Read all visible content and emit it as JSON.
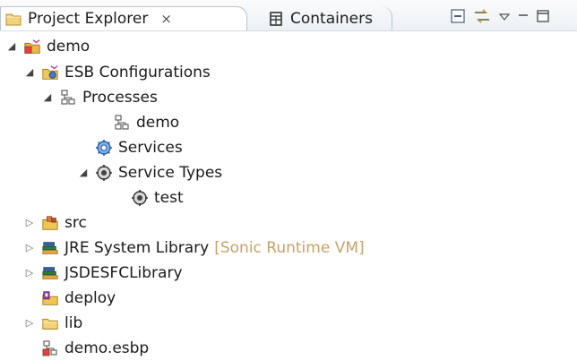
{
  "tabs": [
    {
      "label": "Project Explorer",
      "close": "×",
      "active": true,
      "icon": "project-explorer-icon"
    },
    {
      "label": "Containers",
      "active": false,
      "icon": "containers-icon"
    }
  ],
  "view_toolbar": {
    "items": [
      "collapse-all-icon",
      "link-with-editor-icon",
      "view-menu-icon",
      "minimize-icon",
      "maximize-icon"
    ]
  },
  "tree": [
    {
      "label": "demo",
      "icon": "project-icon",
      "twisty": "expanded"
    },
    {
      "label": "ESB Configurations",
      "icon": "esb-configurations-icon",
      "twisty": "expanded"
    },
    {
      "label": "Processes",
      "icon": "processes-icon",
      "twisty": "expanded"
    },
    {
      "label": "demo",
      "icon": "process-icon",
      "twisty": "none"
    },
    {
      "label": "Services",
      "icon": "services-icon",
      "twisty": "none"
    },
    {
      "label": "Service Types",
      "icon": "service-types-icon",
      "twisty": "expanded"
    },
    {
      "label": "test",
      "icon": "service-type-icon",
      "twisty": "none"
    },
    {
      "label": "src",
      "icon": "source-folder-icon",
      "twisty": "collapsed"
    },
    {
      "label": "JRE System Library",
      "decor": "[Sonic Runtime VM]",
      "icon": "library-icon",
      "twisty": "collapsed"
    },
    {
      "label": "JSDESFCLibrary",
      "icon": "library-icon",
      "twisty": "collapsed"
    },
    {
      "label": "deploy",
      "icon": "deploy-folder-icon",
      "twisty": "none"
    },
    {
      "label": "lib",
      "icon": "folder-icon",
      "twisty": "collapsed"
    },
    {
      "label": "demo.esbp",
      "icon": "esbp-file-icon",
      "twisty": "none"
    }
  ],
  "colors": {
    "decoration": "#c7a26a",
    "tab_border": "#b7c3d3"
  }
}
